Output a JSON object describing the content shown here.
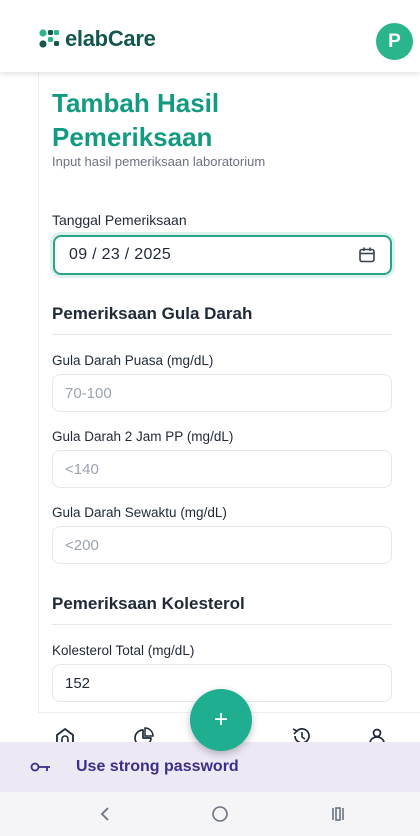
{
  "header": {
    "brand_prefix": "elab",
    "brand_suffix": "Care",
    "avatar_initial": "P",
    "brand_color": "#14574f",
    "avatar_color": "#2bb58d"
  },
  "page": {
    "title": "Tambah Hasil Pemeriksaan",
    "subtitle": "Input hasil pemeriksaan laboratorium",
    "accent_color": "#139b82"
  },
  "date": {
    "label": "Tanggal Pemeriksaan",
    "value": "09 / 23 / 2025"
  },
  "sections": {
    "gula": {
      "title": "Pemeriksaan Gula Darah",
      "fields": [
        {
          "label": "Gula Darah Puasa (mg/dL)",
          "placeholder": "70-100",
          "value": ""
        },
        {
          "label": "Gula Darah 2 Jam PP (mg/dL)",
          "placeholder": "<140",
          "value": ""
        },
        {
          "label": "Gula Darah Sewaktu (mg/dL)",
          "placeholder": "<200",
          "value": ""
        }
      ]
    },
    "kolesterol": {
      "title": "Pemeriksaan Kolesterol",
      "fields": [
        {
          "label": "Kolesterol Total (mg/dL)",
          "placeholder": "",
          "value": "152"
        }
      ]
    }
  },
  "bottom_nav": {
    "fab_label": "+",
    "icons": [
      "home-icon",
      "chart-icon",
      "history-icon",
      "profile-icon"
    ]
  },
  "password_suggestion": {
    "text": "Use strong password",
    "icon": "key-icon"
  },
  "system_nav": {
    "icons": [
      "back-icon",
      "home-circle-icon",
      "recents-icon"
    ]
  }
}
